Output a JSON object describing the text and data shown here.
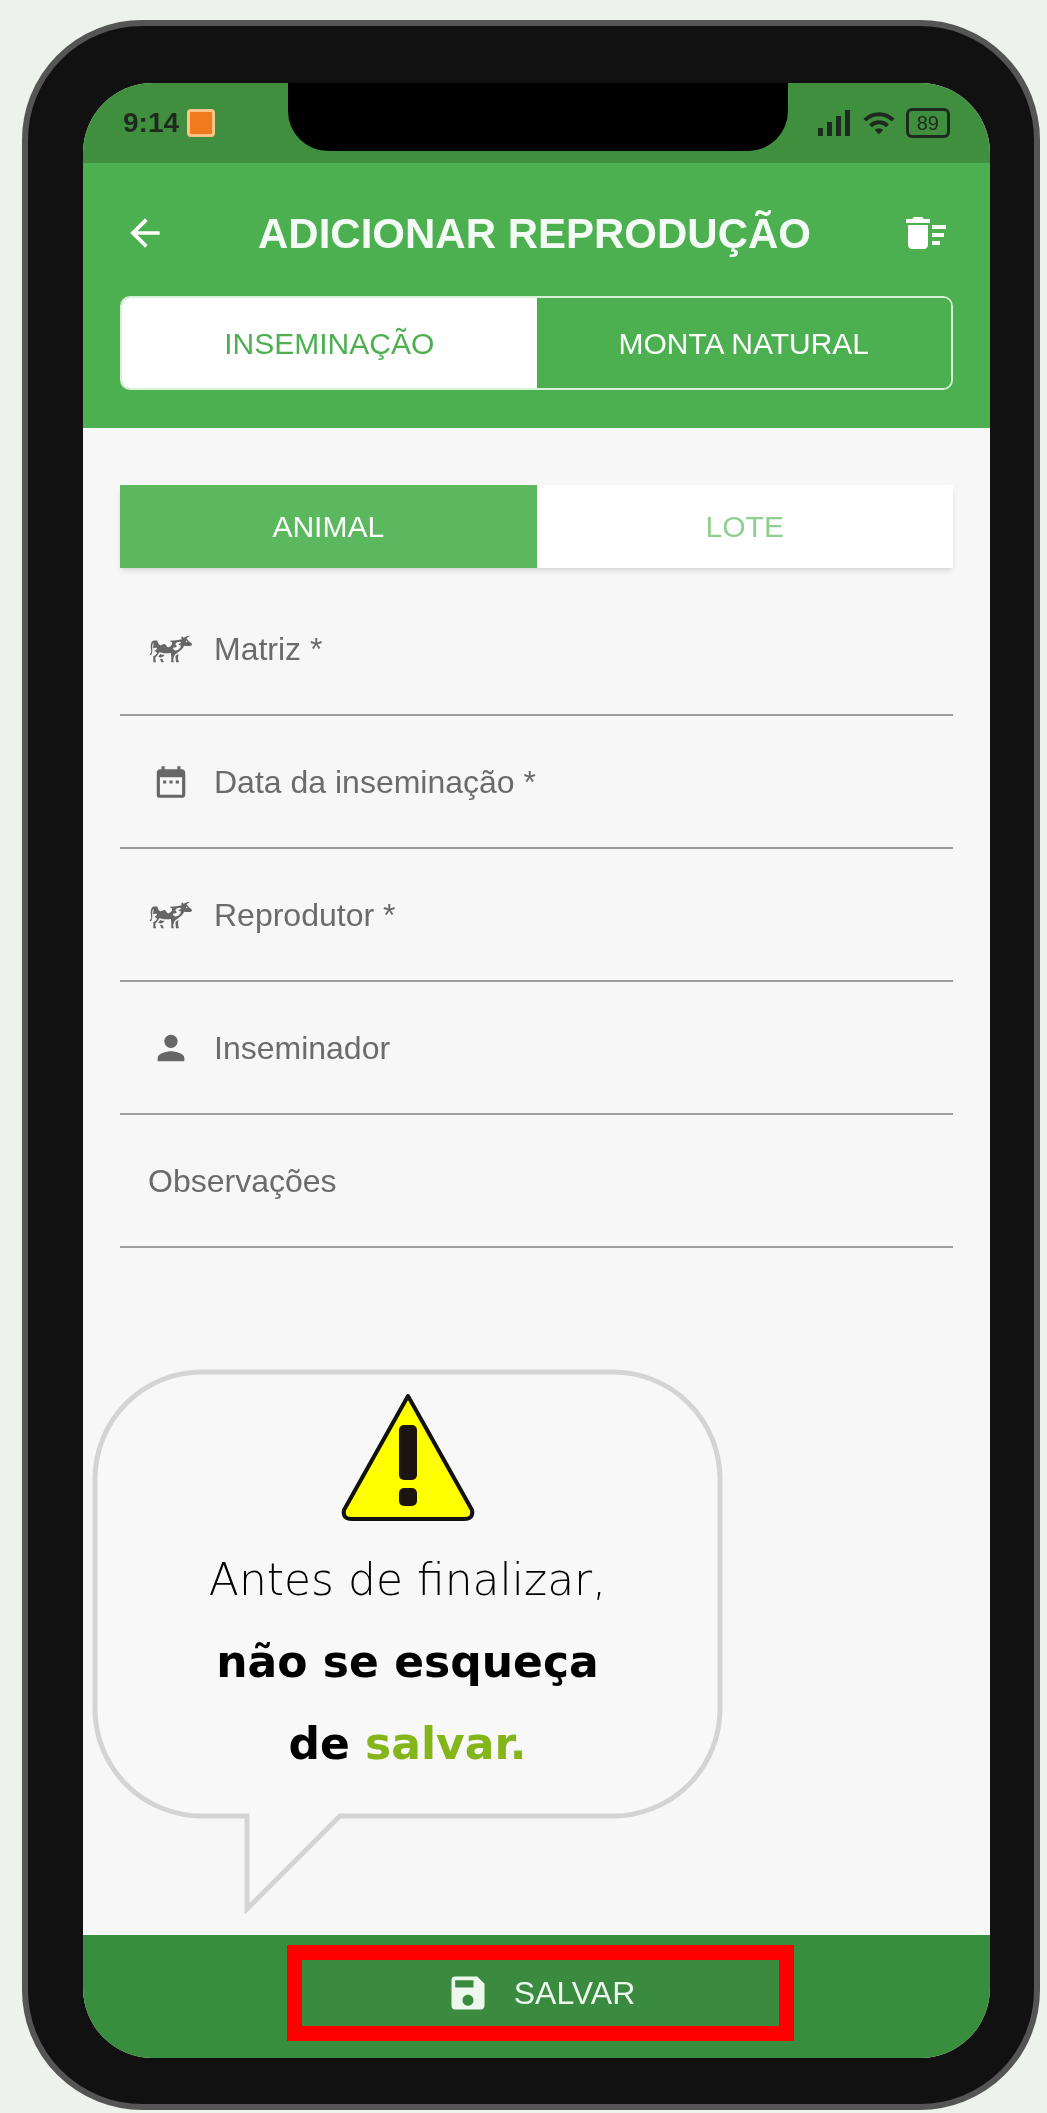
{
  "status_bar": {
    "time": "9:14",
    "battery": "89"
  },
  "app_bar": {
    "title": "ADICIONAR REPRODUÇÃO"
  },
  "tabs": [
    {
      "label": "INSEMINAÇÃO",
      "selected": true
    },
    {
      "label": "MONTA NATURAL",
      "selected": false
    }
  ],
  "target_tabs": [
    {
      "label": "ANIMAL",
      "selected": true
    },
    {
      "label": "LOTE",
      "selected": false
    }
  ],
  "fields": [
    {
      "kind": "cow",
      "placeholder": "Matriz *"
    },
    {
      "kind": "calendar",
      "placeholder": "Data da inseminação *"
    },
    {
      "kind": "cow",
      "placeholder": "Reprodutor *"
    },
    {
      "kind": "person",
      "placeholder": "Inseminador"
    },
    {
      "kind": "none",
      "placeholder": "Observações"
    }
  ],
  "callout": {
    "intro": "Antes de finalizar,",
    "emphasis": "não se esqueça",
    "lead": "de",
    "highlight": "salvar."
  },
  "save_button": {
    "label": "SALVAR",
    "highlighted": true
  }
}
